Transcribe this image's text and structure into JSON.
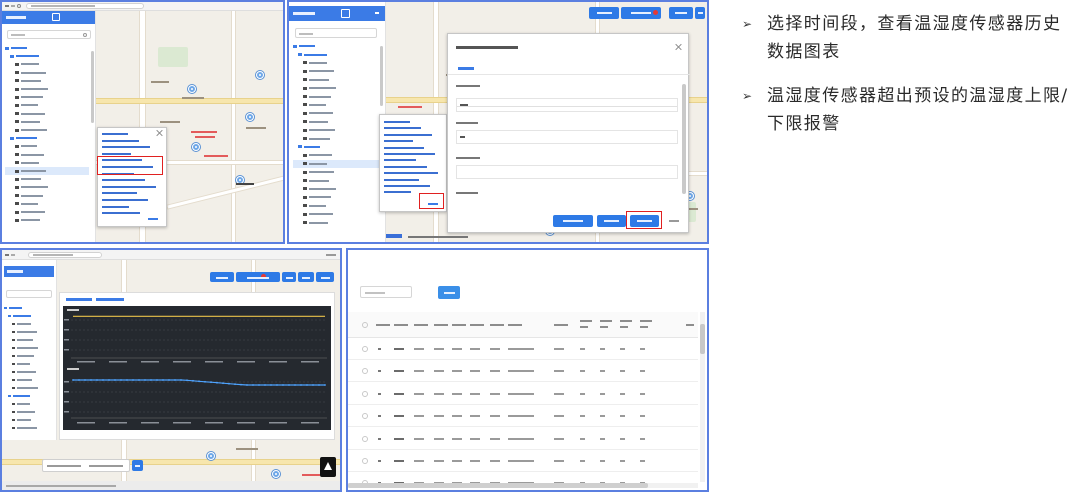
{
  "slide": {
    "bullet_glyph": "➢",
    "bullets": [
      {
        "text": "选择时间段，查看温湿度传感器历史数据图表"
      },
      {
        "text": "温湿度传感器超出预设的温湿度上限/下限报警"
      }
    ]
  },
  "icons": {
    "bullet": "arrow-bullet-icon",
    "search": "search-icon",
    "close": "close-icon",
    "map_marker": "map-pin-icon",
    "sensor": "sensor-icon",
    "folder": "folder-icon"
  },
  "colors": {
    "panel_border": "#5b7fe0",
    "primary": "#2e7ae6",
    "header": "#3b7be6",
    "alert_outline": "#e02020",
    "chart_background": "#25292f",
    "temperature_line": "#e8c24a",
    "humidity_line": "#4ea3ff",
    "text": "#2a2a2a"
  }
}
